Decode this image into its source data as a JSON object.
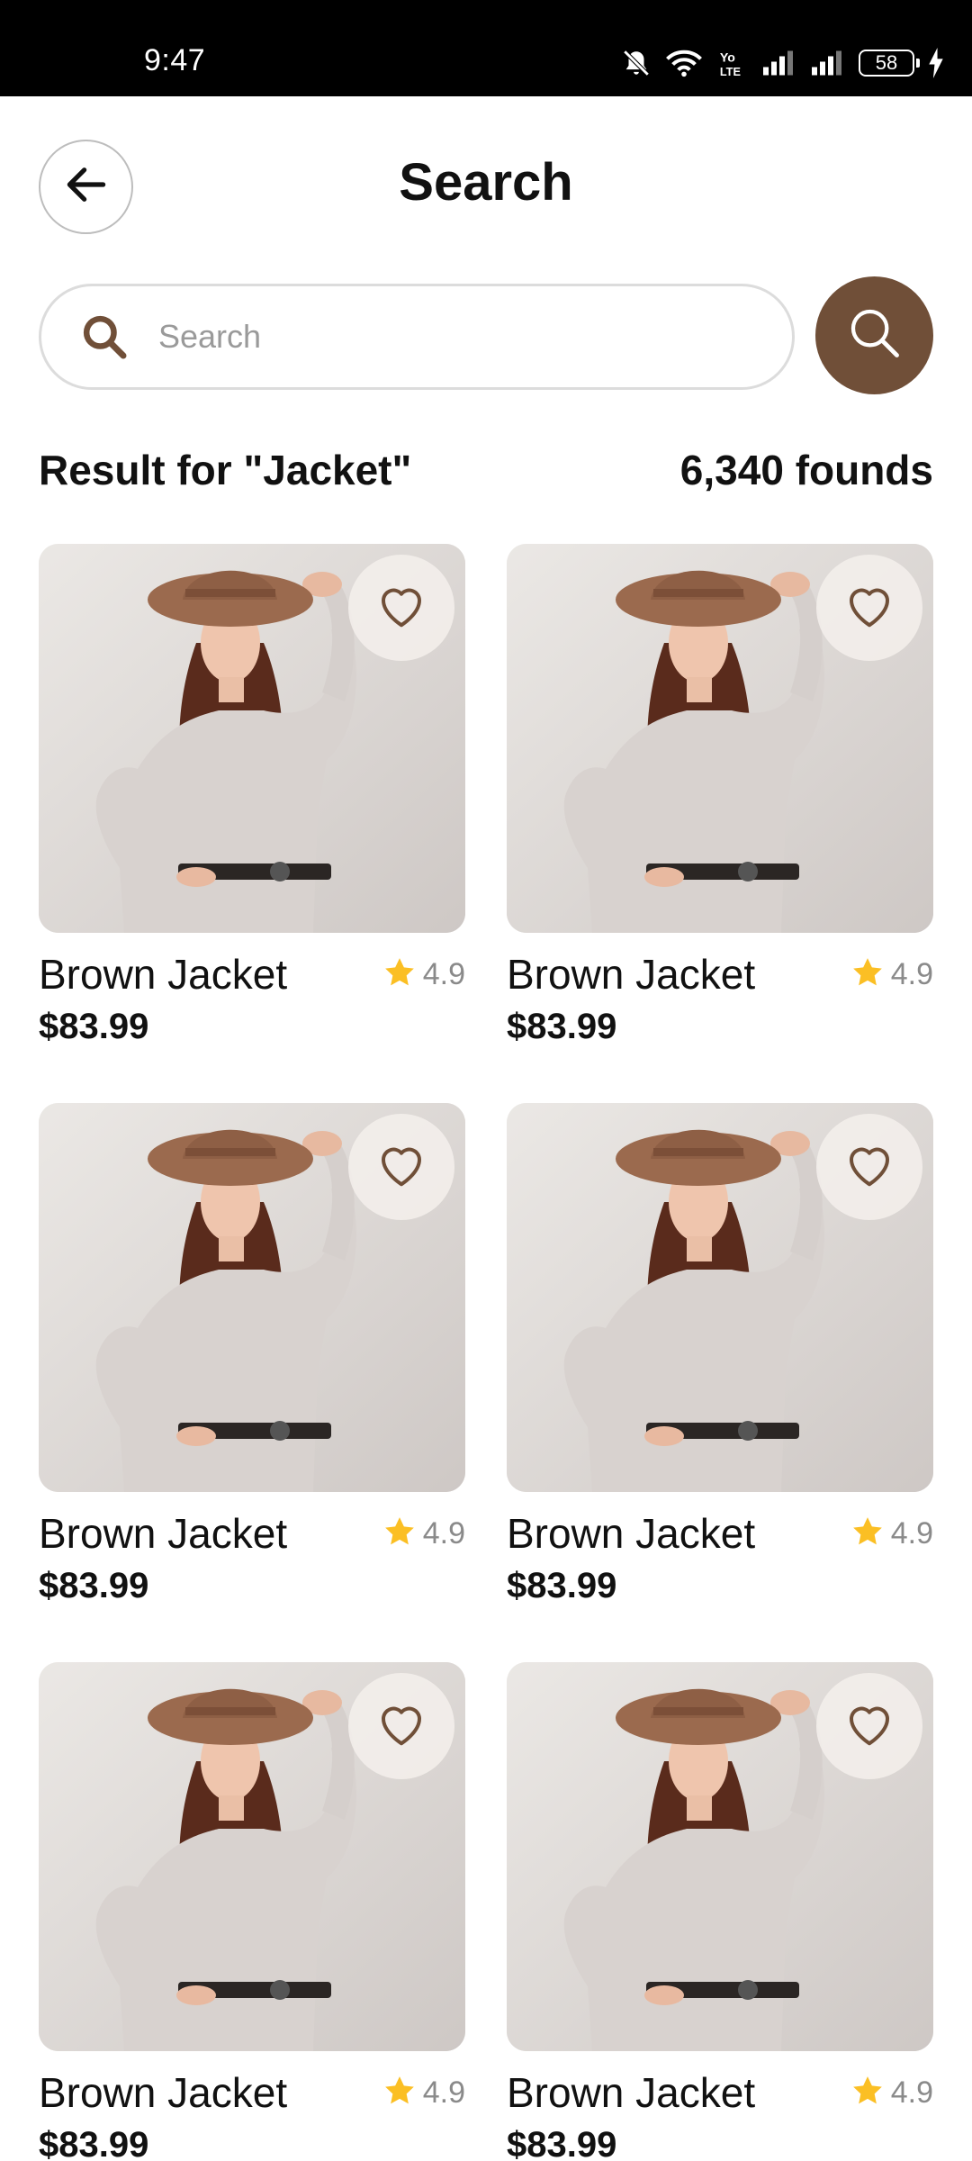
{
  "status_bar": {
    "time": "9:47",
    "battery": "58",
    "icons": [
      "mute-icon",
      "wifi-icon",
      "volte-icon",
      "signal-icon",
      "signal-icon",
      "battery-icon",
      "charging-icon"
    ]
  },
  "header": {
    "title": "Search",
    "back_icon": "arrow-left-icon"
  },
  "search": {
    "placeholder": "Search",
    "value": "",
    "submit_icon": "search-icon"
  },
  "results": {
    "label": "Result for \"Jacket\"",
    "count": "6,340 founds"
  },
  "products": [
    {
      "name": "Brown Jacket",
      "price": "$83.99",
      "rating": "4.9"
    },
    {
      "name": "Brown Jacket",
      "price": "$83.99",
      "rating": "4.9"
    },
    {
      "name": "Brown Jacket",
      "price": "$83.99",
      "rating": "4.9"
    },
    {
      "name": "Brown Jacket",
      "price": "$83.99",
      "rating": "4.9"
    },
    {
      "name": "Brown Jacket",
      "price": "$83.99",
      "rating": "4.9"
    },
    {
      "name": "Brown Jacket",
      "price": "$83.99",
      "rating": "4.9"
    }
  ],
  "colors": {
    "accent": "#704f38",
    "star": "#fbbf24",
    "text": "#111111",
    "muted": "#8a8a8a"
  }
}
